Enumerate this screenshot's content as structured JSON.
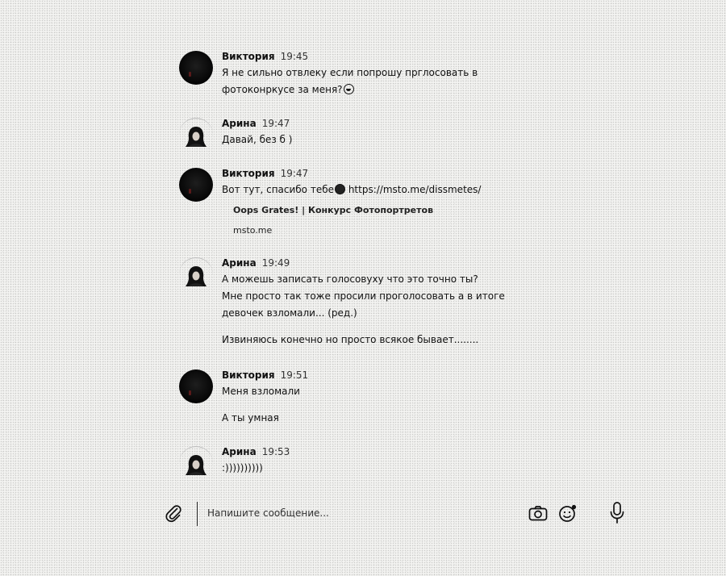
{
  "messages": [
    {
      "author": "Виктория",
      "time": "19:45",
      "avatar": "dark",
      "lines": [
        "Я не сильно отвлеку если попрошу прглосовать в",
        "фотоконркусе за меня?"
      ],
      "emoji": "laughing-emoji"
    },
    {
      "author": "Арина",
      "time": "19:47",
      "avatar": "portrait",
      "lines": [
        "Давай, без б )"
      ]
    },
    {
      "author": "Виктория",
      "time": "19:47",
      "avatar": "dark",
      "text_before_emoji": "Вот тут, спасибо тебе",
      "emoji": "kiss-emoji",
      "text_after_emoji": " https://msto.me/dissmetes/",
      "link_preview": {
        "title": "Oops Grates! | Конкурс Фотопортретов",
        "url": "msto.me"
      }
    },
    {
      "author": "Арина",
      "time": "19:49",
      "avatar": "portrait",
      "lines": [
        "А можешь записать голосовуху что это точно ты?",
        "Мне просто так тоже просили проголосовать а в итоге",
        "девочек взломали... (ред.)"
      ],
      "followup": "Извиняюсь конечно но просто всякое бывает........"
    },
    {
      "author": "Виктория",
      "time": "19:51",
      "avatar": "dark",
      "lines": [
        "Меня взломали"
      ],
      "followup": "А ты умная"
    },
    {
      "author": "Арина",
      "time": "19:53",
      "avatar": "portrait",
      "lines": [
        ":))))))))))"
      ]
    }
  ],
  "composer": {
    "placeholder": "Напишите сообщение...",
    "icons": [
      "paperclip-icon",
      "camera-icon",
      "sticker-icon",
      "microphone-icon"
    ]
  }
}
